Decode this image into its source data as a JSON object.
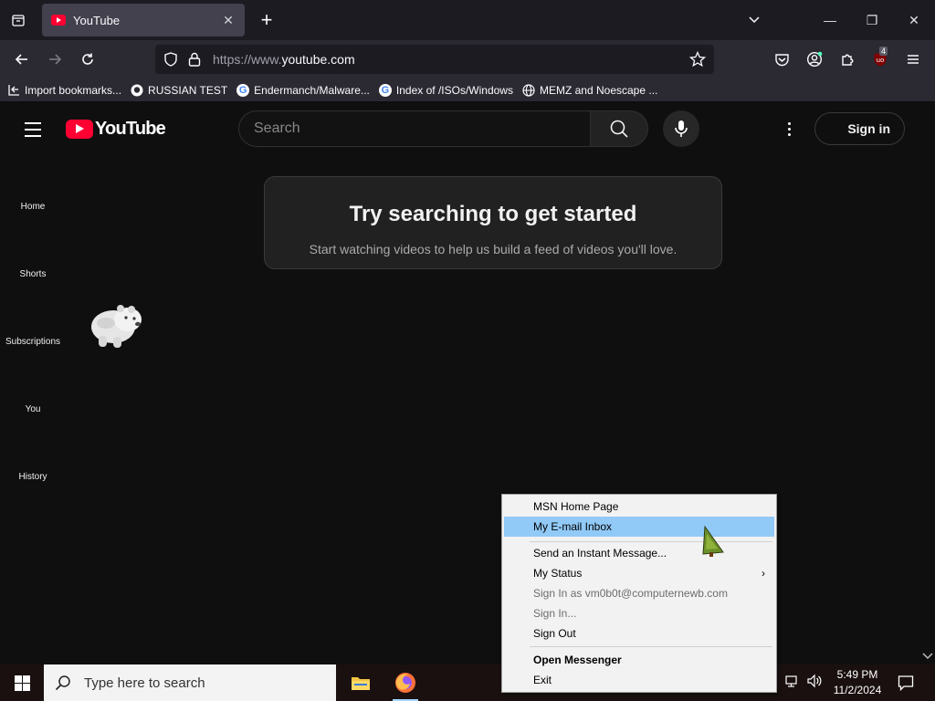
{
  "browser": {
    "tab": {
      "title": "YouTube",
      "close_glyph": "✕"
    },
    "new_tab_glyph": "+",
    "window": {
      "minimize": "—",
      "restore": "❐",
      "close": "✕"
    },
    "url": {
      "prefix": "https://www.",
      "domain": "youtube.com"
    },
    "extension_badge": "4",
    "bookmarks": [
      {
        "label": "Import bookmarks...",
        "icon": "import-icon"
      },
      {
        "label": "RUSSIAN TEST",
        "icon": "github-icon"
      },
      {
        "label": "Endermanch/Malware...",
        "icon": "google-icon"
      },
      {
        "label": "Index of /ISOs/Windows",
        "icon": "google-icon"
      },
      {
        "label": "MEMZ and Noescape ...",
        "icon": "globe-icon"
      }
    ]
  },
  "youtube": {
    "logo_text": "YouTube",
    "search_placeholder": "Search",
    "signin_label": "Sign in",
    "sidebar": [
      {
        "label": "Home"
      },
      {
        "label": "Shorts"
      },
      {
        "label": "Subscriptions"
      },
      {
        "label": "You"
      },
      {
        "label": "History"
      }
    ],
    "empty_state": {
      "title": "Try searching to get started",
      "subtitle": "Start watching videos to help us build a feed of videos you'll love."
    }
  },
  "context_menu": {
    "items": [
      {
        "label": "MSN Home Page"
      },
      {
        "label": "My E-mail Inbox",
        "highlighted": true
      },
      {
        "label": "Send an Instant Message..."
      },
      {
        "label": "My Status",
        "submenu_arrow": "›"
      },
      {
        "label": "Sign In as vm0b0t@computernewb.com",
        "disabled": true
      },
      {
        "label": "Sign In...",
        "disabled": true
      },
      {
        "label": "Sign Out"
      },
      {
        "label": "Open Messenger",
        "bold": true
      },
      {
        "label": "Exit"
      }
    ]
  },
  "taskbar": {
    "search_placeholder": "Type here to search",
    "time": "5:49 PM",
    "date": "11/2/2024"
  },
  "colors": {
    "youtube_red": "#ff0033",
    "menu_highlight": "#91c9f7",
    "firefox_tabbar": "#1c1b22"
  }
}
